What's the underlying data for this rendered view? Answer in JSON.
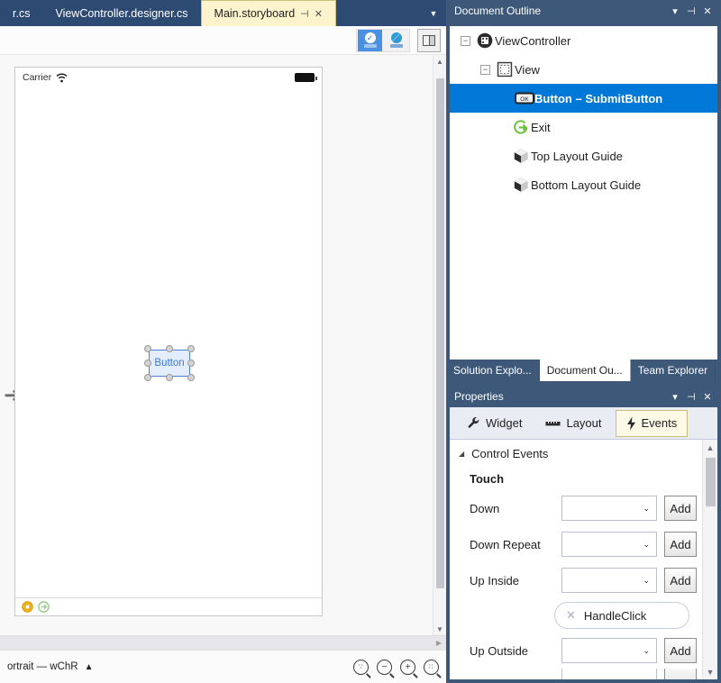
{
  "editor": {
    "tabs": [
      {
        "label": "r.cs",
        "active": false,
        "truncated": true
      },
      {
        "label": "ViewController.designer.cs",
        "active": false
      },
      {
        "label": "Main.storyboard",
        "active": true,
        "pin": "⊣",
        "close": "✕"
      }
    ],
    "overflow_icon": "chevron-down-icon"
  },
  "designer_toolbar": {
    "constraints_mode_label": "constraints-toggle",
    "frame_mode_label": "frame-toggle",
    "split_view_label": "split-view-toggle"
  },
  "canvas": {
    "device": {
      "carrier": "Carrier",
      "wifi_icon": "wifi-icon",
      "battery_icon": "battery-icon"
    },
    "widget": {
      "label": "Button"
    },
    "footer_icons": [
      "view-controller-badge-icon",
      "exit-segue-icon"
    ],
    "entry_arrow": "entry-point-arrow-icon"
  },
  "status_strip": {
    "orientation": "ortrait — wChR",
    "expander_icon": "triangle-up-icon",
    "zoom_buttons": [
      "zoom-to-fit",
      "zoom-out",
      "zoom-in",
      "zoom-actual-size"
    ]
  },
  "document_outline": {
    "title": "Document Outline",
    "header_buttons": [
      "▾",
      "⊣",
      "✕"
    ],
    "nodes": [
      {
        "indent": 0,
        "twisty": "−",
        "icon": "view-controller-icon",
        "label": "ViewController",
        "selected": false
      },
      {
        "indent": 1,
        "twisty": "−",
        "icon": "view-icon",
        "label": "View",
        "selected": false
      },
      {
        "indent": 2,
        "twisty": "",
        "icon": "button-icon",
        "label": "Button  –  SubmitButton",
        "selected": true
      },
      {
        "indent": 2,
        "twisty": "",
        "icon": "exit-icon",
        "label": "Exit",
        "selected": false
      },
      {
        "indent": 2,
        "twisty": "",
        "icon": "layout-guide-icon",
        "label": "Top Layout Guide",
        "selected": false
      },
      {
        "indent": 2,
        "twisty": "",
        "icon": "layout-guide-icon",
        "label": "Bottom Layout Guide",
        "selected": false
      }
    ]
  },
  "dock_tabs": [
    {
      "label": "Solution Explo...",
      "active": false
    },
    {
      "label": "Document Ou...",
      "active": true
    },
    {
      "label": "Team Explorer",
      "active": false
    }
  ],
  "properties": {
    "title": "Properties",
    "header_buttons": [
      "▾",
      "⊣",
      "✕"
    ],
    "tabs": [
      {
        "label": "Widget",
        "icon": "wrench-icon",
        "active": false
      },
      {
        "label": "Layout",
        "icon": "ruler-icon",
        "active": false
      },
      {
        "label": "Events",
        "icon": "lightning-icon",
        "active": true
      }
    ],
    "group": {
      "label": "Control Events",
      "expanded_icon": "triangle-expanded-icon"
    },
    "section": "Touch",
    "add_label": "Add",
    "combo_value": "",
    "combo_chevron": "⌄",
    "rows": [
      {
        "label": "Down",
        "value": "",
        "handler": null
      },
      {
        "label": "Down Repeat",
        "value": "",
        "handler": null
      },
      {
        "label": "Up Inside",
        "value": "",
        "handler": "HandleClick"
      },
      {
        "label": "Up Outside",
        "value": "",
        "handler": null
      }
    ],
    "handler_remove_icon": "✕"
  },
  "colors": {
    "dock_blue": "#3d5878",
    "tab_blue": "#2d4a72",
    "active_tab_yellow": "#fdf4cd",
    "selection_blue": "#0078d7",
    "widget_blue": "#3b78d8"
  }
}
